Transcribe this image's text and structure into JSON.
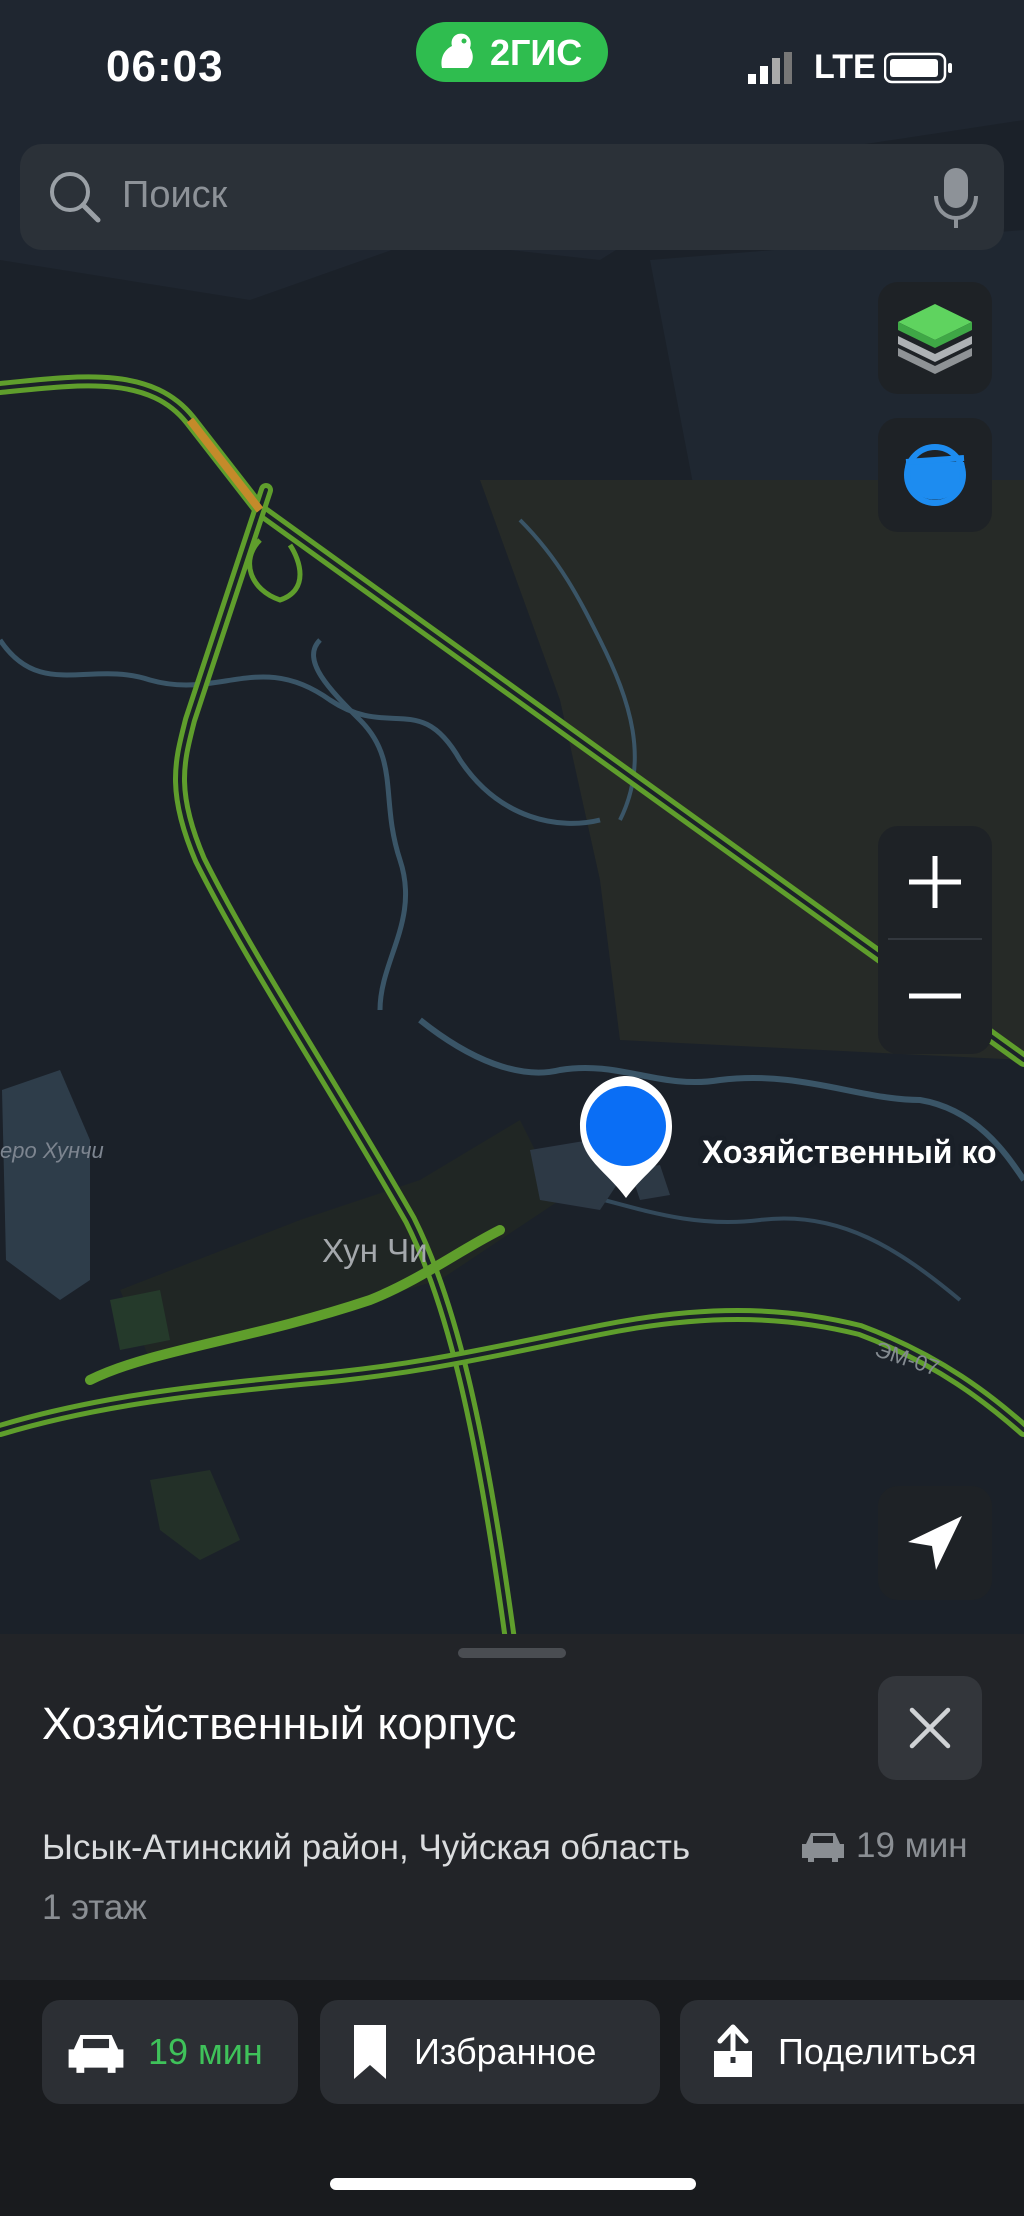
{
  "status_bar": {
    "time": "06:03",
    "brand": "2ГИС",
    "network": "LTE"
  },
  "search": {
    "placeholder": "Поиск"
  },
  "map": {
    "poi_label": "Хозяйственный ко",
    "town_label": "Хун Чи",
    "lake_label": "еро Хунчи",
    "road_label": "ЭМ-07",
    "icons": {
      "layers": "layers-icon",
      "compass": "compass-icon",
      "zoom_in": "plus-icon",
      "zoom_out": "minus-icon",
      "locate": "navigation-arrow-icon"
    },
    "colors": {
      "background": "#1b2129",
      "road": "#5f9e2c",
      "water": "#3a5567",
      "pin": "#0a6ef5"
    }
  },
  "place_card": {
    "title": "Хозяйственный корпус",
    "address": "Ысык-Атинский район, Чуйская область",
    "floor": "1 этаж",
    "eta": "19 мин"
  },
  "actions": [
    {
      "label": "19 мин",
      "icon": "car-icon"
    },
    {
      "label": "Избранное",
      "icon": "bookmark-icon"
    },
    {
      "label": "Поделиться",
      "icon": "share-icon"
    }
  ]
}
